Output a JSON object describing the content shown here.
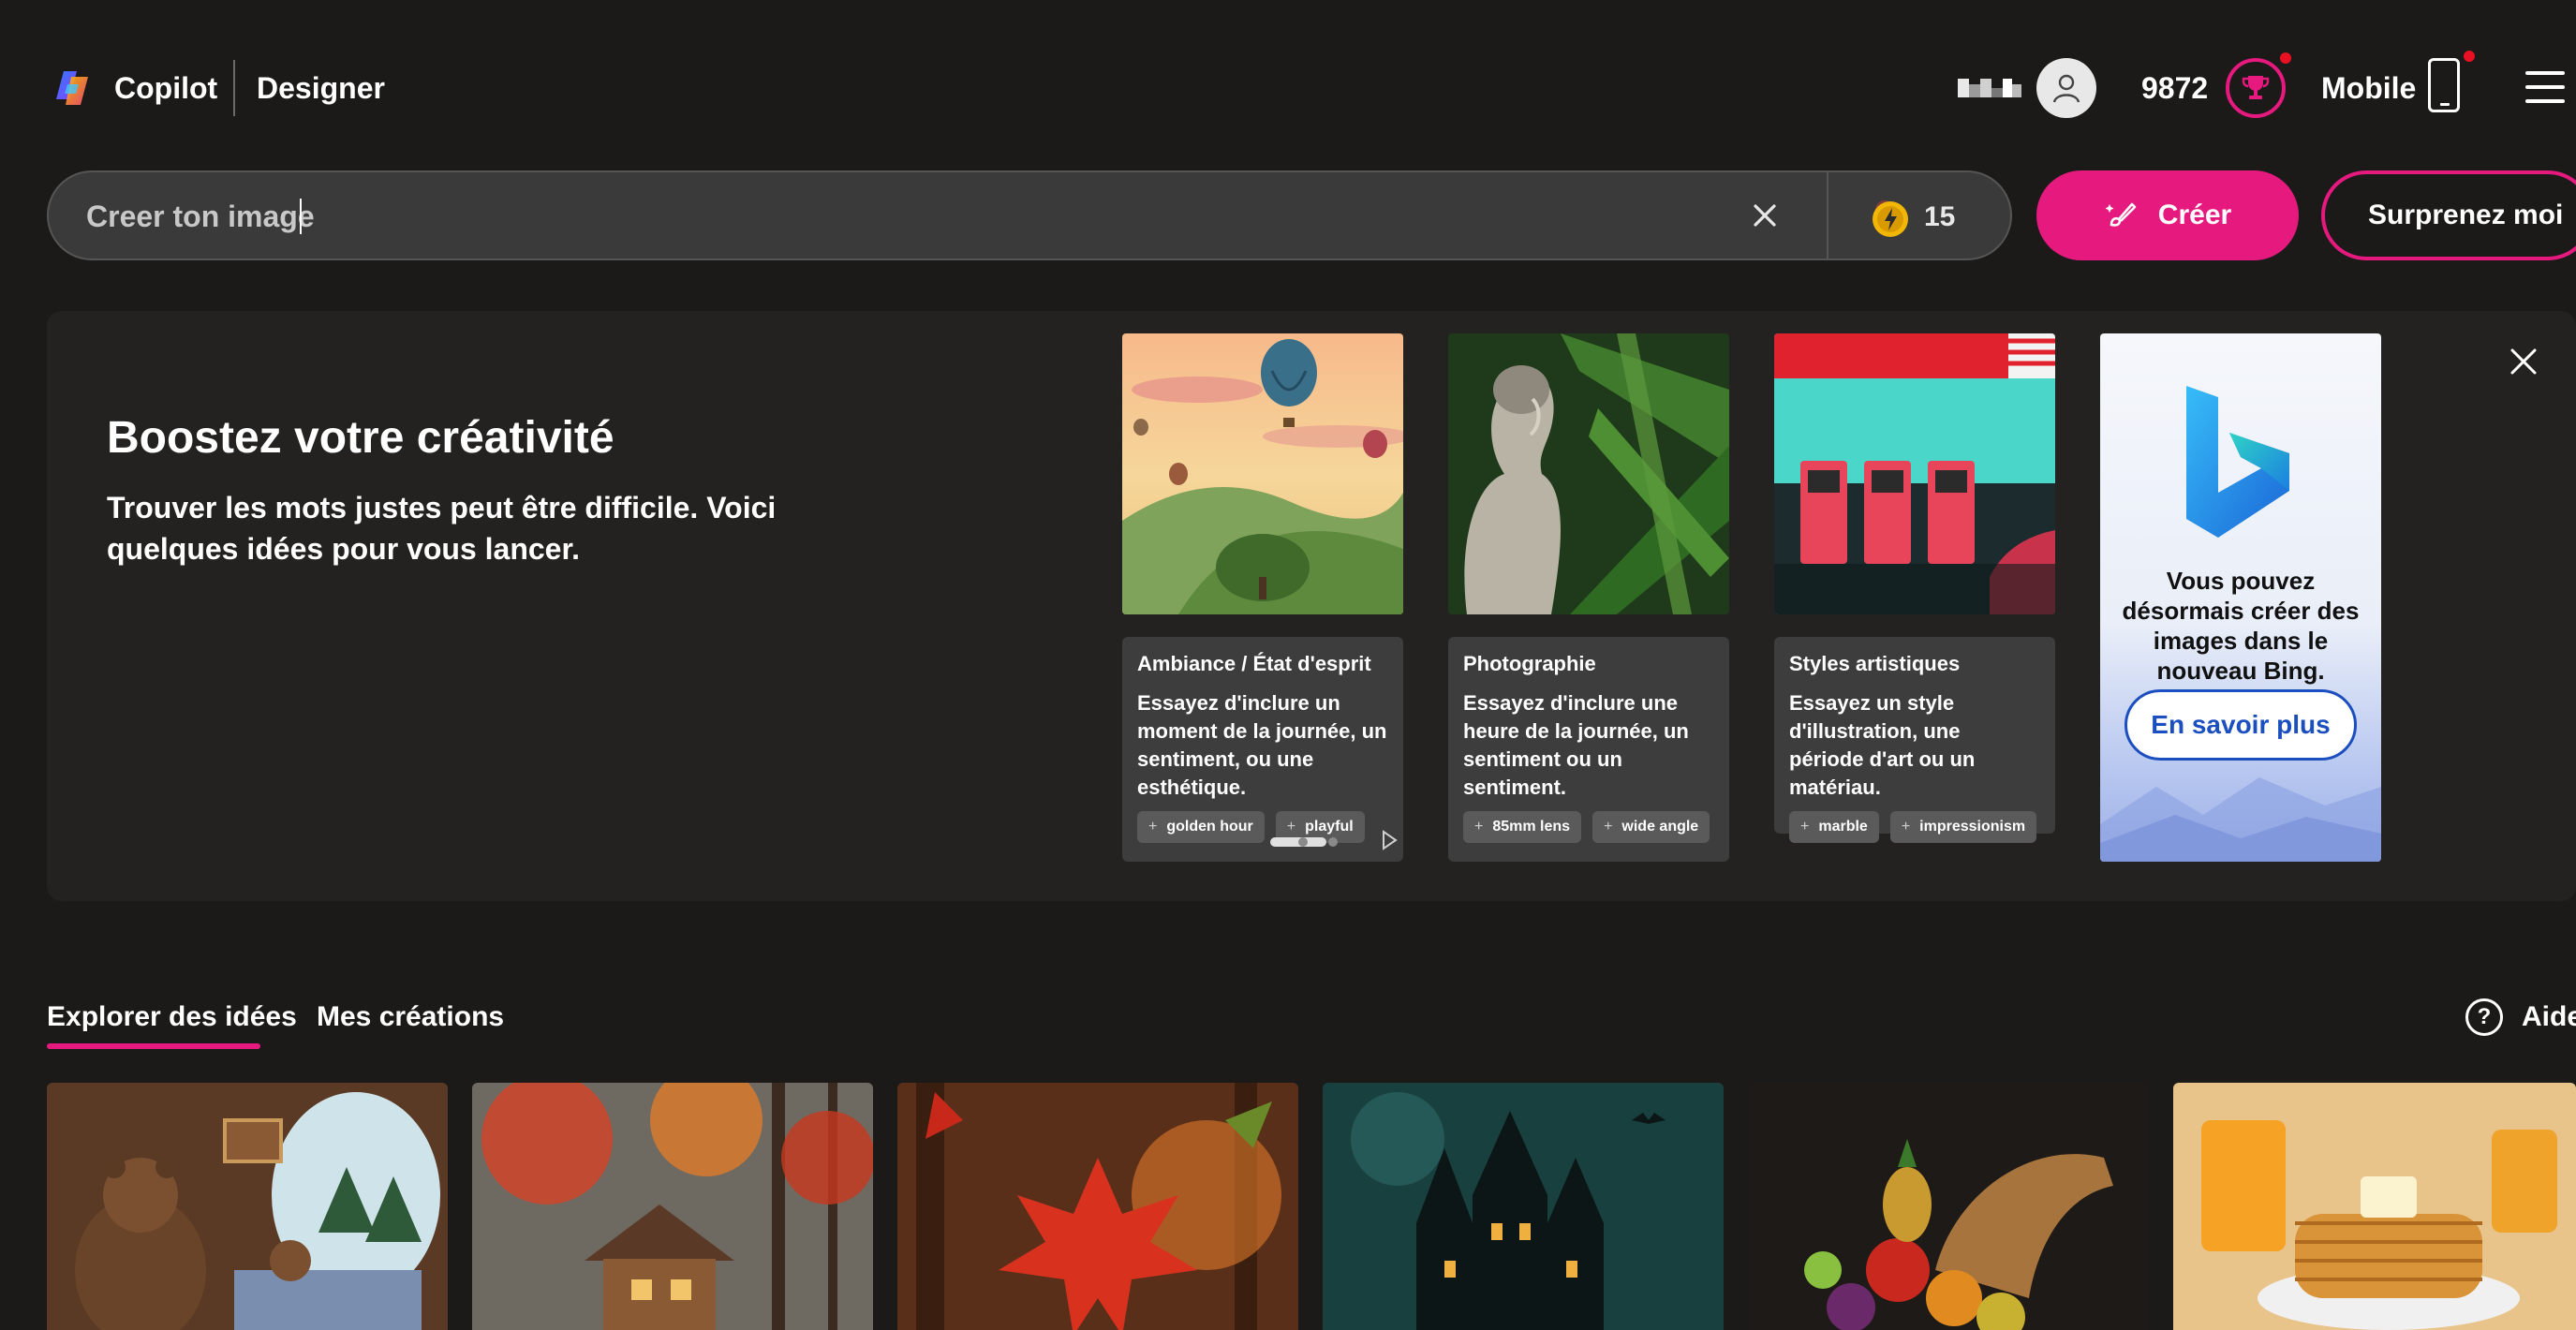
{
  "header": {
    "brand": "Copilot",
    "product": "Designer",
    "points": "9872",
    "mobile_label": "Mobile"
  },
  "search": {
    "value": "",
    "placeholder": "Creer ton image",
    "coins": "15",
    "create_label": "Créer",
    "surprise_label": "Surprenez moi"
  },
  "boost": {
    "title": "Boostez votre créativité",
    "description": "Trouver les mots justes peut être difficile. Voici quelques idées pour vous lancer.",
    "cards": [
      {
        "heading": "Ambiance / État d'esprit",
        "text": "Essayez d'inclure un moment de la journée, un sentiment, ou une esthétique.",
        "chips": [
          "golden hour",
          "playful"
        ]
      },
      {
        "heading": "Photographie",
        "text": "Essayez d'inclure une heure de la journée, un sentiment ou un sentiment.",
        "chips": [
          "85mm lens",
          "wide angle"
        ]
      },
      {
        "heading": "Styles artistiques",
        "text": "Essayez un style d'illustration, une période d'art ou un matériau.",
        "chips": [
          "marble",
          "impressionism"
        ]
      }
    ],
    "promo": {
      "text": "Vous pouvez désormais créer des images dans le nouveau Bing.",
      "button": "En savoir plus"
    }
  },
  "tabs": {
    "explore": "Explorer des idées",
    "mine": "Mes créations",
    "help": "Aide"
  },
  "colors": {
    "accent": "#e6197e",
    "background": "#1b1a19",
    "panel": "#232221"
  }
}
